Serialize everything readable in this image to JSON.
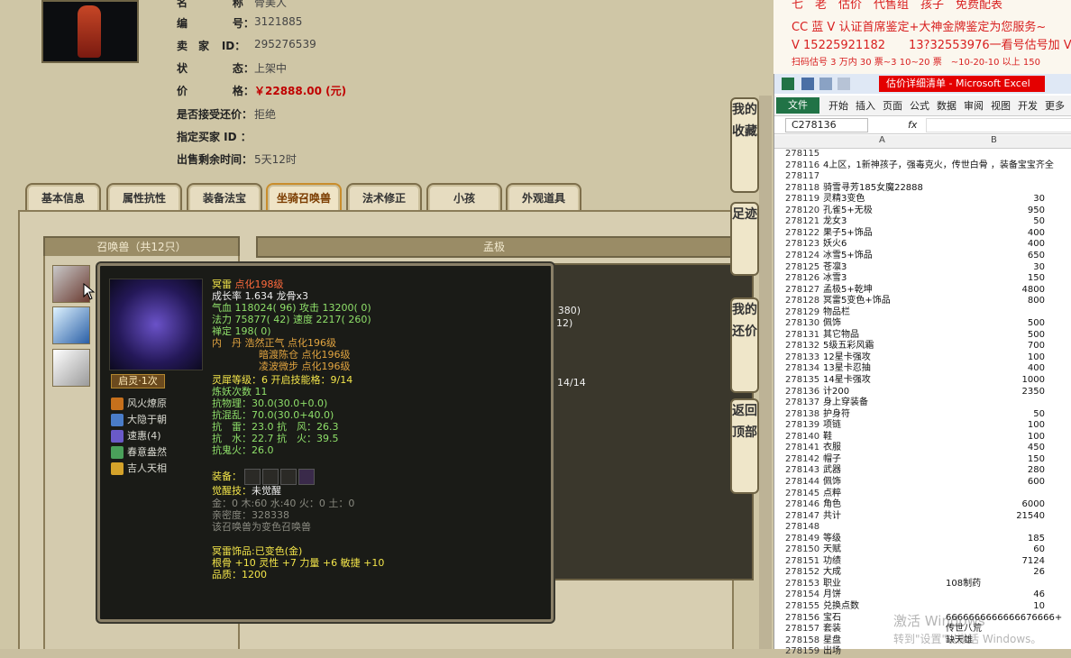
{
  "listing": {
    "name_label": "名",
    "name_sep": "称",
    "name_value": "骨美人",
    "id_label": "编",
    "id_sep": "号：",
    "id_value": "3121885",
    "seller_label": "卖　家",
    "seller_sep": "ID：",
    "seller_value": "295276539",
    "status_label": "状",
    "status_sep": "态：",
    "status_value": "上架中",
    "price_label": "价",
    "price_sep": "格：",
    "price_value": "￥22888.00 (元)",
    "counter_label": "是否接受还价：",
    "counter_value": "拒绝",
    "buyer_label": "指定买家 ID ：",
    "buyer_value": "",
    "remain_label": "出售剩余时间：",
    "remain_value": "5天12时"
  },
  "tabs": [
    "基本信息",
    "属性抗性",
    "装备法宝",
    "坐骑召唤兽",
    "法术修正",
    "小孩",
    "外观道具"
  ],
  "active_tab": 3,
  "summon_panel": {
    "header": "召唤兽（共12只）",
    "right_header": "孟极"
  },
  "right_dark_fragments": [
    "5( 380)",
    "212)",
    "14/14"
  ],
  "side_buttons": [
    "我的收藏",
    "足迹",
    "我的还价",
    "返回顶部"
  ],
  "tooltip": {
    "name": "冥雷",
    "name_suffix": "点化198级",
    "growth": "成长率 1.634 龙骨x3",
    "hp": "气血 118024( 96) 攻击 13200( 0)",
    "mp": "法力 75877( 42) 速度 2217( 260)",
    "ling": "禅定 198( 0)",
    "neidan1": "内　丹 浩然正气 点化196级",
    "neidan2": "暗渡陈仓 点化196级",
    "neidan3": "凌波微步 点化196级",
    "soul_level": "灵犀等级：6 开启技能格：9/14",
    "lianyao": "炼妖次数 11",
    "res_phys": "抗物理：30.0(30.0+0.0)",
    "res_mix": "抗混乱：70.0(30.0+40.0)",
    "res_line1": "抗　雷：23.0 抗　风：26.3",
    "res_line2": "抗　水：22.7 抗　火：39.5",
    "res_ghost": "抗鬼火：26.0",
    "equip_label": "装备：",
    "awaken": "觉醒技：",
    "awaken_value": "未觉醒",
    "elements": "金：0 木:60 水:40 火：0 土：0",
    "intimacy": "亲密度：328338",
    "transform_note": "该召唤兽为变色召唤兽",
    "decoration": "冥雷饰品:已变色(金)",
    "attrs": "根骨 +10 灵性 +7 力量 +6 敏捷 +10",
    "quality": "品质：1200",
    "qiling": "启灵·1次",
    "skills": [
      "风火燎原",
      "大隐于朝",
      "速惠(4)",
      "春意盎然",
      "吉人天相"
    ]
  },
  "ad_lines": [
    "七　老　估价　代售组　孩子　免费配表",
    "CC 蓝 V 认证首席鉴定+大神金牌鉴定为您服务~",
    "V 15225921182　　13?32553976一看号估号加 V",
    "扫码估号 3 万内 30 票~3 10~20 票　~10-20-10 以上 150"
  ],
  "excel": {
    "title": "估价详细清单 - Microsoft Excel",
    "ribbon_tabs": [
      "开始",
      "插入",
      "页面",
      "公式",
      "数据",
      "审阅",
      "视图",
      "开发",
      "更多"
    ],
    "file_tab": "文件",
    "name_box": "C278136",
    "fx": "fx",
    "col_a": "A",
    "col_b": "B",
    "rows": [
      {
        "n": "278115",
        "a": "",
        "b": ""
      },
      {
        "n": "278116",
        "a": "4上区，1新神孩子，强毒克火，传世白骨 ，装备宝宝齐全",
        "b": ""
      },
      {
        "n": "278117",
        "a": "",
        "b": ""
      },
      {
        "n": "278118",
        "a": "骑雪寻芳185女魔22888",
        "b": ""
      },
      {
        "n": "278119",
        "a": "灵精3变色",
        "b": "30"
      },
      {
        "n": "278120",
        "a": "孔雀5+无极",
        "b": "950"
      },
      {
        "n": "278121",
        "a": "龙女3",
        "b": "50"
      },
      {
        "n": "278122",
        "a": "果子5+饰品",
        "b": "400"
      },
      {
        "n": "278123",
        "a": "妖火6",
        "b": "400"
      },
      {
        "n": "278124",
        "a": "冰雪5+饰品",
        "b": "650"
      },
      {
        "n": "278125",
        "a": "苍凛3",
        "b": "30"
      },
      {
        "n": "278126",
        "a": "冰雪3",
        "b": "150"
      },
      {
        "n": "278127",
        "a": "孟极5+乾坤",
        "b": "4800"
      },
      {
        "n": "278128",
        "a": "冥雷5变色+饰品",
        "b": "800"
      },
      {
        "n": "278129",
        "a": "物品栏",
        "b": ""
      },
      {
        "n": "278130",
        "a": "佩饰",
        "b": "500"
      },
      {
        "n": "278131",
        "a": "其它物品",
        "b": "500"
      },
      {
        "n": "278132",
        "a": "5级五彩风霜",
        "b": "700"
      },
      {
        "n": "278133",
        "a": "12星卡强攻",
        "b": "100"
      },
      {
        "n": "278134",
        "a": "13星卡忍抽",
        "b": "400"
      },
      {
        "n": "278135",
        "a": "14星卡强攻",
        "b": "1000"
      },
      {
        "n": "278136",
        "a": "计200",
        "b": "2350"
      },
      {
        "n": "278137",
        "a": "身上穿装备",
        "b": ""
      },
      {
        "n": "278138",
        "a": "护身符",
        "b": "50"
      },
      {
        "n": "278139",
        "a": "项链",
        "b": "100"
      },
      {
        "n": "278140",
        "a": "鞋",
        "b": "100"
      },
      {
        "n": "278141",
        "a": "衣服",
        "b": "450"
      },
      {
        "n": "278142",
        "a": "帽子",
        "b": "150"
      },
      {
        "n": "278143",
        "a": "武器",
        "b": "280"
      },
      {
        "n": "278144",
        "a": "佩饰",
        "b": "600"
      },
      {
        "n": "278145",
        "a": "点粹",
        "b": ""
      },
      {
        "n": "278146",
        "a": "角色",
        "b": "6000"
      },
      {
        "n": "278147",
        "a": "共计",
        "b": "21540"
      },
      {
        "n": "278148",
        "a": "",
        "b": ""
      },
      {
        "n": "278149",
        "a": "等级",
        "b": "185"
      },
      {
        "n": "278150",
        "a": "天赋",
        "b": "60"
      },
      {
        "n": "278151",
        "a": "功绩",
        "b": "7124"
      },
      {
        "n": "278152",
        "a": "大成",
        "b": "26"
      },
      {
        "n": "278153",
        "a": "职业",
        "bl": "108制药"
      },
      {
        "n": "278154",
        "a": "月饼",
        "b": "46"
      },
      {
        "n": "278155",
        "a": "兑换点数",
        "b": "10"
      },
      {
        "n": "278156",
        "a": "宝石",
        "bl": "6666666666666676666+"
      },
      {
        "n": "278157",
        "a": "套装",
        "bl": "传世八荒"
      },
      {
        "n": "278158",
        "a": "星盘",
        "bl": "缺天雄"
      },
      {
        "n": "278159",
        "a": "出场",
        "bl": ""
      }
    ],
    "watermark1": "激活 Windows",
    "watermark2": "转到\"设置\"以激活 Windows。"
  }
}
